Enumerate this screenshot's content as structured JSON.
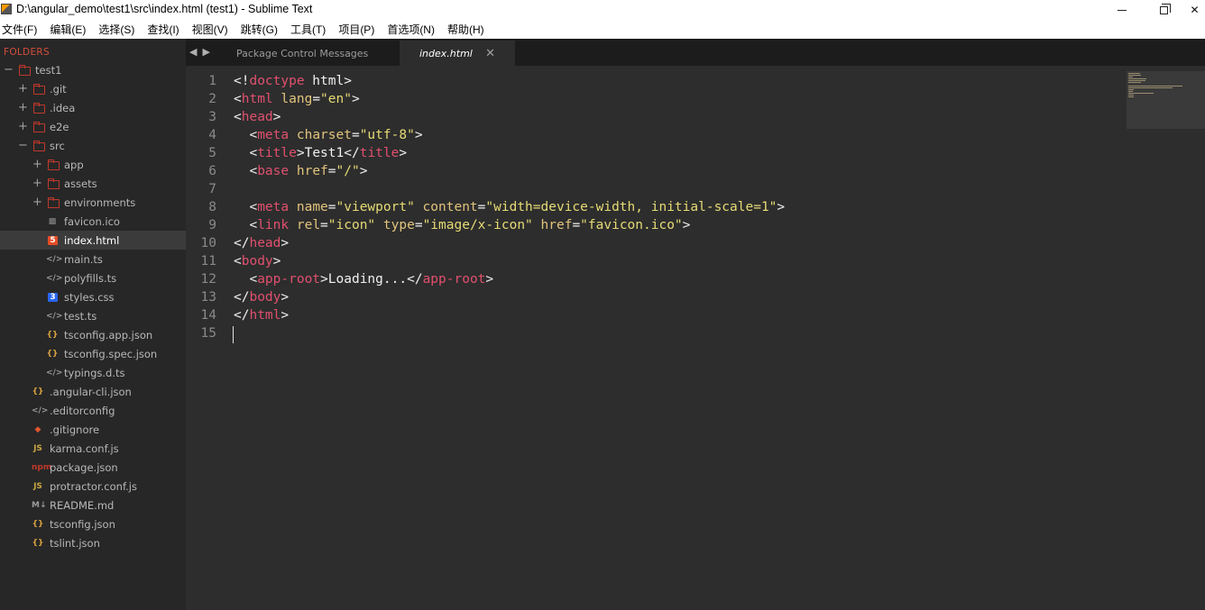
{
  "window": {
    "title": "D:\\angular_demo\\test1\\src\\index.html (test1) - Sublime Text"
  },
  "menu": [
    "文件(F)",
    "编辑(E)",
    "选择(S)",
    "查找(I)",
    "视图(V)",
    "跳转(G)",
    "工具(T)",
    "项目(P)",
    "首选项(N)",
    "帮助(H)"
  ],
  "sidebar": {
    "header": "FOLDERS",
    "tree": [
      {
        "label": "test1",
        "type": "folder",
        "depth": 0,
        "expanded": true
      },
      {
        "label": ".git",
        "type": "folder",
        "depth": 1,
        "expanded": false
      },
      {
        "label": ".idea",
        "type": "folder",
        "depth": 1,
        "expanded": false
      },
      {
        "label": "e2e",
        "type": "folder",
        "depth": 1,
        "expanded": false
      },
      {
        "label": "src",
        "type": "folder",
        "depth": 1,
        "expanded": true
      },
      {
        "label": "app",
        "type": "folder",
        "depth": 2,
        "expanded": false
      },
      {
        "label": "assets",
        "type": "folder",
        "depth": 2,
        "expanded": false
      },
      {
        "label": "environments",
        "type": "folder",
        "depth": 2,
        "expanded": false
      },
      {
        "label": "favicon.ico",
        "type": "file",
        "icon": "image-icon",
        "depth": 2
      },
      {
        "label": "index.html",
        "type": "file",
        "icon": "html5-icon",
        "depth": 2,
        "selected": true
      },
      {
        "label": "main.ts",
        "type": "file",
        "icon": "code-icon",
        "depth": 2
      },
      {
        "label": "polyfills.ts",
        "type": "file",
        "icon": "code-icon",
        "depth": 2
      },
      {
        "label": "styles.css",
        "type": "file",
        "icon": "css3-icon",
        "depth": 2
      },
      {
        "label": "test.ts",
        "type": "file",
        "icon": "code-icon",
        "depth": 2
      },
      {
        "label": "tsconfig.app.json",
        "type": "file",
        "icon": "json-icon",
        "depth": 2
      },
      {
        "label": "tsconfig.spec.json",
        "type": "file",
        "icon": "json-icon",
        "depth": 2
      },
      {
        "label": "typings.d.ts",
        "type": "file",
        "icon": "code-icon",
        "depth": 2
      },
      {
        "label": ".angular-cli.json",
        "type": "file",
        "icon": "json-icon",
        "depth": 1
      },
      {
        "label": ".editorconfig",
        "type": "file",
        "icon": "code-icon",
        "depth": 1
      },
      {
        "label": ".gitignore",
        "type": "file",
        "icon": "git-icon",
        "depth": 1
      },
      {
        "label": "karma.conf.js",
        "type": "file",
        "icon": "js-icon",
        "depth": 1
      },
      {
        "label": "package.json",
        "type": "file",
        "icon": "npm-icon",
        "depth": 1
      },
      {
        "label": "protractor.conf.js",
        "type": "file",
        "icon": "js-icon",
        "depth": 1
      },
      {
        "label": "README.md",
        "type": "file",
        "icon": "markdown-icon",
        "depth": 1
      },
      {
        "label": "tsconfig.json",
        "type": "file",
        "icon": "json-icon",
        "depth": 1
      },
      {
        "label": "tslint.json",
        "type": "file",
        "icon": "json-icon",
        "depth": 1
      }
    ]
  },
  "tabs": [
    {
      "label": "Package Control Messages",
      "active": false
    },
    {
      "label": "index.html",
      "active": true
    }
  ],
  "editor": {
    "line_numbers": [
      "1",
      "2",
      "3",
      "4",
      "5",
      "6",
      "7",
      "8",
      "9",
      "10",
      "11",
      "12",
      "13",
      "14",
      "15"
    ],
    "lines": [
      [
        [
          "p",
          "<!"
        ],
        [
          "t",
          "doctype"
        ],
        [
          "x",
          " html"
        ],
        [
          "p",
          ">"
        ]
      ],
      [
        [
          "p",
          "<"
        ],
        [
          "t",
          "html"
        ],
        [
          "a",
          " lang"
        ],
        [
          "p",
          "="
        ],
        [
          "s",
          "\"en\""
        ],
        [
          "p",
          ">"
        ]
      ],
      [
        [
          "p",
          "<"
        ],
        [
          "t",
          "head"
        ],
        [
          "p",
          ">"
        ]
      ],
      [
        [
          "x",
          "  "
        ],
        [
          "p",
          "<"
        ],
        [
          "t",
          "meta"
        ],
        [
          "a",
          " charset"
        ],
        [
          "p",
          "="
        ],
        [
          "s",
          "\"utf-8\""
        ],
        [
          "p",
          ">"
        ]
      ],
      [
        [
          "x",
          "  "
        ],
        [
          "p",
          "<"
        ],
        [
          "t",
          "title"
        ],
        [
          "p",
          ">"
        ],
        [
          "x",
          "Test1"
        ],
        [
          "p",
          "</"
        ],
        [
          "t",
          "title"
        ],
        [
          "p",
          ">"
        ]
      ],
      [
        [
          "x",
          "  "
        ],
        [
          "p",
          "<"
        ],
        [
          "t",
          "base"
        ],
        [
          "a",
          " href"
        ],
        [
          "p",
          "="
        ],
        [
          "s",
          "\"/\""
        ],
        [
          "p",
          ">"
        ]
      ],
      [],
      [
        [
          "x",
          "  "
        ],
        [
          "p",
          "<"
        ],
        [
          "t",
          "meta"
        ],
        [
          "a",
          " name"
        ],
        [
          "p",
          "="
        ],
        [
          "s",
          "\"viewport\""
        ],
        [
          "a",
          " content"
        ],
        [
          "p",
          "="
        ],
        [
          "s",
          "\"width=device-width, initial-scale=1\""
        ],
        [
          "p",
          ">"
        ]
      ],
      [
        [
          "x",
          "  "
        ],
        [
          "p",
          "<"
        ],
        [
          "t",
          "link"
        ],
        [
          "a",
          " rel"
        ],
        [
          "p",
          "="
        ],
        [
          "s",
          "\"icon\""
        ],
        [
          "a",
          " type"
        ],
        [
          "p",
          "="
        ],
        [
          "s",
          "\"image/x-icon\""
        ],
        [
          "a",
          " href"
        ],
        [
          "p",
          "="
        ],
        [
          "s",
          "\"favicon.ico\""
        ],
        [
          "p",
          ">"
        ]
      ],
      [
        [
          "p",
          "</"
        ],
        [
          "t",
          "head"
        ],
        [
          "p",
          ">"
        ]
      ],
      [
        [
          "p",
          "<"
        ],
        [
          "t",
          "body"
        ],
        [
          "p",
          ">"
        ]
      ],
      [
        [
          "x",
          "  "
        ],
        [
          "p",
          "<"
        ],
        [
          "t",
          "app-root"
        ],
        [
          "p",
          ">"
        ],
        [
          "x",
          "Loading..."
        ],
        [
          "p",
          "</"
        ],
        [
          "t",
          "app-root"
        ],
        [
          "p",
          ">"
        ]
      ],
      [
        [
          "p",
          "</"
        ],
        [
          "t",
          "body"
        ],
        [
          "p",
          ">"
        ]
      ],
      [
        [
          "p",
          "</"
        ],
        [
          "t",
          "html"
        ],
        [
          "p",
          ">"
        ]
      ],
      []
    ]
  },
  "colors": {
    "tag": "#e0506e",
    "attribute": "#e2c47c",
    "string": "#e6db74",
    "folders_header": "#d64e3a"
  }
}
